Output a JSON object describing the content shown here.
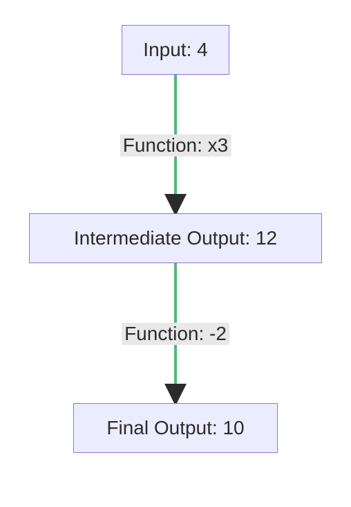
{
  "diagram": {
    "nodes": {
      "input": {
        "label": "Input: 4"
      },
      "intermediate": {
        "label": "Intermediate Output: 12"
      },
      "final": {
        "label": "Final Output: 10"
      }
    },
    "edges": {
      "e1": {
        "label": "Function: x3"
      },
      "e2": {
        "label": "Function: -2"
      }
    }
  },
  "semantic": {
    "input_value": 4,
    "step1_function": "x3",
    "intermediate_value": 12,
    "step2_function": "-2",
    "final_value": 10
  }
}
